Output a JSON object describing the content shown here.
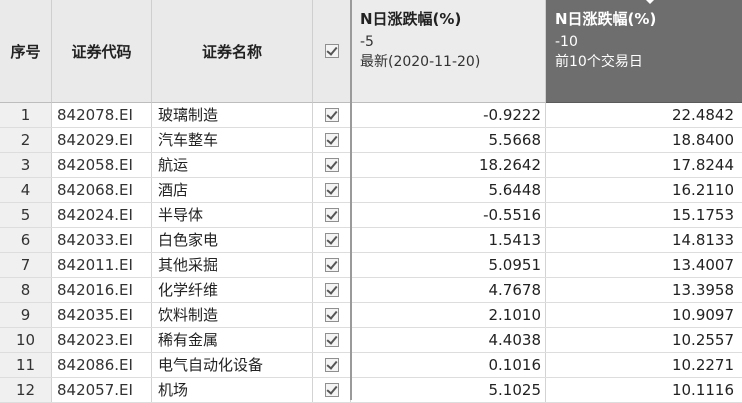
{
  "header": {
    "index_label": "序号",
    "code_label": "证券代码",
    "name_label": "证券名称",
    "col_n5": {
      "title": "N日涨跌幅(%)",
      "param": "-5",
      "date": "最新(2020-11-20)"
    },
    "col_n10": {
      "title": "N日涨跌幅(%)",
      "param": "-10",
      "date": "前10个交易日"
    }
  },
  "rows": [
    {
      "idx": "1",
      "code": "842078.EI",
      "name": "玻璃制造",
      "n5": "-0.9222",
      "n10": "22.4842"
    },
    {
      "idx": "2",
      "code": "842029.EI",
      "name": "汽车整车",
      "n5": "5.5668",
      "n10": "18.8400"
    },
    {
      "idx": "3",
      "code": "842058.EI",
      "name": "航运",
      "n5": "18.2642",
      "n10": "17.8244"
    },
    {
      "idx": "4",
      "code": "842068.EI",
      "name": "酒店",
      "n5": "5.6448",
      "n10": "16.2110"
    },
    {
      "idx": "5",
      "code": "842024.EI",
      "name": "半导体",
      "n5": "-0.5516",
      "n10": "15.1753"
    },
    {
      "idx": "6",
      "code": "842033.EI",
      "name": "白色家电",
      "n5": "1.5413",
      "n10": "14.8133"
    },
    {
      "idx": "7",
      "code": "842011.EI",
      "name": "其他采掘",
      "n5": "5.0951",
      "n10": "13.4007"
    },
    {
      "idx": "8",
      "code": "842016.EI",
      "name": "化学纤维",
      "n5": "4.7678",
      "n10": "13.3958"
    },
    {
      "idx": "9",
      "code": "842035.EI",
      "name": "饮料制造",
      "n5": "2.1010",
      "n10": "10.9097"
    },
    {
      "idx": "10",
      "code": "842023.EI",
      "name": "稀有金属",
      "n5": "4.4038",
      "n10": "10.2557"
    },
    {
      "idx": "11",
      "code": "842086.EI",
      "name": "电气自动化设备",
      "n5": "0.1016",
      "n10": "10.2271"
    },
    {
      "idx": "12",
      "code": "842057.EI",
      "name": "机场",
      "n5": "5.1025",
      "n10": "10.1116"
    }
  ],
  "theme": {
    "header_dark_bg": "#6e6e6e",
    "header_light_bg": "#eaeaea",
    "index_bg": "#f0f0f0"
  }
}
